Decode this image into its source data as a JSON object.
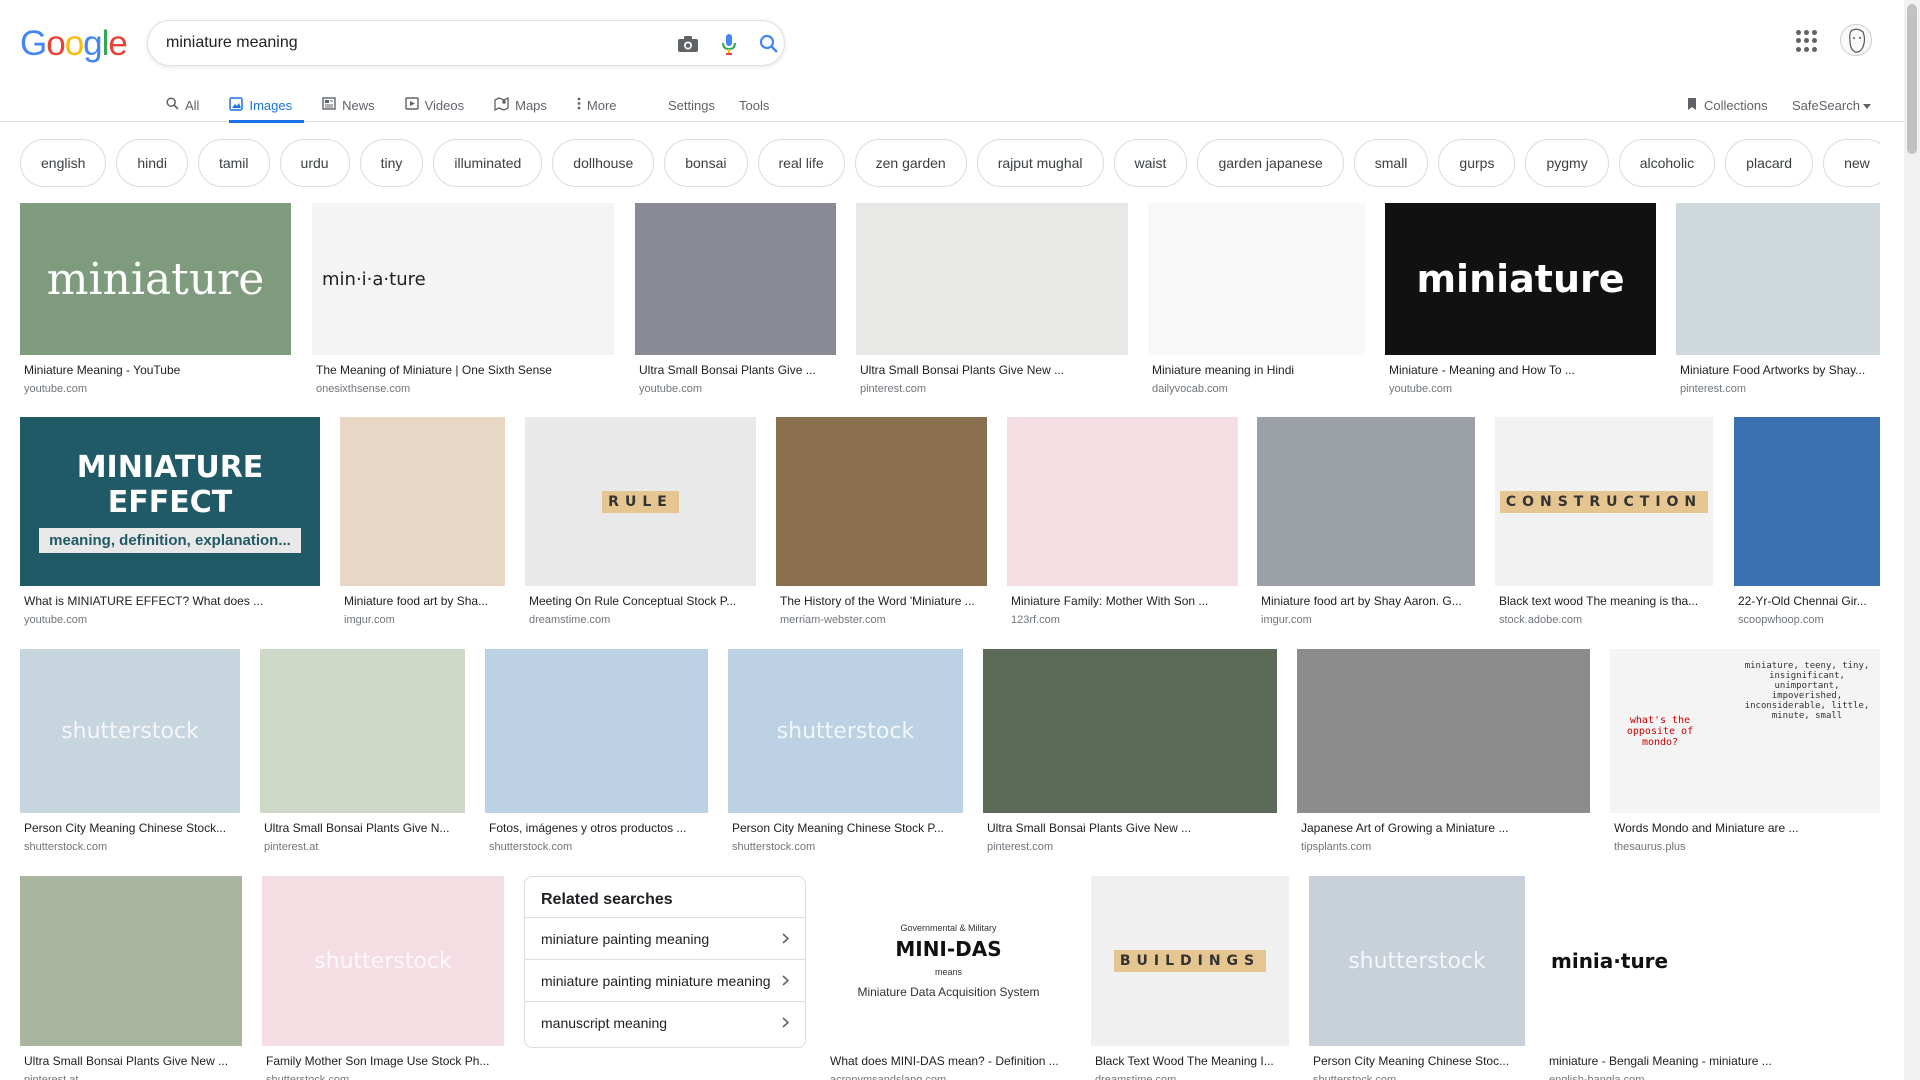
{
  "logo": {
    "g1": "G",
    "o1": "o",
    "o2": "o",
    "g2": "g",
    "l": "l",
    "e": "e"
  },
  "search": {
    "value": "miniature meaning"
  },
  "tabs": [
    {
      "label": "All"
    },
    {
      "label": "Images"
    },
    {
      "label": "News"
    },
    {
      "label": "Videos"
    },
    {
      "label": "Maps"
    },
    {
      "label": "More"
    }
  ],
  "tools": {
    "settings": "Settings",
    "tools": "Tools",
    "collections": "Collections",
    "safesearch": "SafeSearch"
  },
  "chips": [
    "english",
    "hindi",
    "tamil",
    "urdu",
    "tiny",
    "illuminated",
    "dollhouse",
    "bonsai",
    "real life",
    "zen garden",
    "rajput mughal",
    "waist",
    "garden japanese",
    "small",
    "gurps",
    "pygmy",
    "alcoholic",
    "placard",
    "new"
  ],
  "results": [
    {
      "caption": "Miniature Meaning - YouTube",
      "source": "youtube.com",
      "thumb_text": "miniature"
    },
    {
      "caption": "The Meaning of Miniature | One Sixth Sense",
      "source": "onesixthsense.com",
      "thumb_text": "min·i·a·ture"
    },
    {
      "caption": "Ultra Small Bonsai Plants Give ...",
      "source": "youtube.com"
    },
    {
      "caption": "Ultra Small Bonsai Plants Give New ...",
      "source": "pinterest.com"
    },
    {
      "caption": "Miniature meaning in Hindi",
      "source": "dailyvocab.com"
    },
    {
      "caption": "Miniature - Meaning and How To ...",
      "source": "youtube.com",
      "thumb_text": "miniature"
    },
    {
      "caption": "Miniature Food Artworks by Shay...",
      "source": "pinterest.com"
    },
    {
      "caption": "What is MINIATURE EFFECT? What does ...",
      "source": "youtube.com",
      "thumb_text": "MINIATURE EFFECT",
      "thumb_sub": "meaning, definition, explanation..."
    },
    {
      "caption": "Miniature food art by Sha...",
      "source": "imgur.com"
    },
    {
      "caption": "Meeting On Rule Conceptual Stock P...",
      "source": "dreamstime.com",
      "thumb_text": "RULE"
    },
    {
      "caption": "The History of the Word 'Miniature ...",
      "source": "merriam-webster.com"
    },
    {
      "caption": "Miniature Family: Mother With Son ...",
      "source": "123rf.com"
    },
    {
      "caption": "Miniature food art by Shay Aaron. G...",
      "source": "imgur.com"
    },
    {
      "caption": "Black text wood The meaning is tha...",
      "source": "stock.adobe.com",
      "thumb_text": "CONSTRUCTION"
    },
    {
      "caption": "22-Yr-Old Chennai Gir...",
      "source": "scoopwhoop.com"
    },
    {
      "caption": "Person City Meaning Chinese Stock...",
      "source": "shutterstock.com",
      "thumb_text": "shutterstock"
    },
    {
      "caption": "Ultra Small Bonsai Plants Give N...",
      "source": "pinterest.at"
    },
    {
      "caption": "Fotos, imágenes y otros productos ...",
      "source": "shutterstock.com"
    },
    {
      "caption": "Person City Meaning Chinese Stock P...",
      "source": "shutterstock.com",
      "thumb_text": "shutterstock"
    },
    {
      "caption": "Ultra Small Bonsai Plants Give New ...",
      "source": "pinterest.com"
    },
    {
      "caption": "Japanese Art of Growing a Miniature ...",
      "source": "tipsplants.com"
    },
    {
      "caption": "Words Mondo and Miniature are ...",
      "source": "thesaurus.plus",
      "thumb_text": "what's the opposite of mondo?",
      "thumb_sub": "miniature, teeny, tiny, insignificant, unimportant, impoverished, inconsiderable, little, minute, small"
    },
    {
      "caption": "Ultra Small Bonsai Plants Give New ...",
      "source": "pinterest.at"
    },
    {
      "caption": "Family Mother Son Image Use Stock Ph...",
      "source": "shutterstock.com",
      "thumb_text": "shutterstock"
    },
    {
      "caption": "What does MINI-DAS mean? - Definition ...",
      "source": "acronymsandslang.com",
      "thumb_text": "MINI-DAS",
      "thumb_sub": "Miniature Data Acquisition System",
      "thumb_top": "Governmental & Military",
      "thumb_means": "means"
    },
    {
      "caption": "Black Text Wood The Meaning I...",
      "source": "dreamstime.com",
      "thumb_text": "BUILDINGS"
    },
    {
      "caption": "Person City Meaning Chinese Stoc...",
      "source": "shutterstock.com",
      "thumb_text": "shutterstock"
    },
    {
      "caption": "miniature - Bengali Meaning - miniature ...",
      "source": "english-bangla.com",
      "thumb_text": "minia·ture"
    }
  ],
  "related": {
    "title": "Related searches",
    "items": [
      "miniature painting meaning",
      "miniature painting miniature meaning",
      "manuscript meaning"
    ]
  }
}
